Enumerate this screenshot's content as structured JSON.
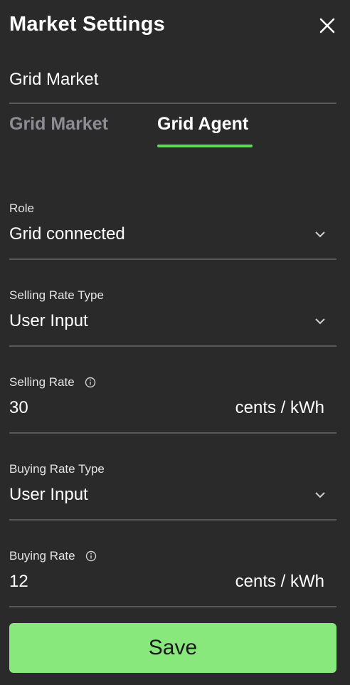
{
  "header": {
    "title": "Market Settings",
    "close_icon": "close-icon"
  },
  "name_field": {
    "value": "Grid Market"
  },
  "tabs": [
    {
      "label": "Grid Market",
      "active": false
    },
    {
      "label": "Grid Agent",
      "active": true
    }
  ],
  "fields": {
    "role": {
      "label": "Role",
      "value": "Grid connected"
    },
    "selling_rate_type": {
      "label": "Selling Rate Type",
      "value": "User Input"
    },
    "selling_rate": {
      "label": "Selling Rate",
      "value": "30",
      "unit": "cents / kWh"
    },
    "buying_rate_type": {
      "label": "Buying Rate Type",
      "value": "User Input"
    },
    "buying_rate": {
      "label": "Buying Rate",
      "value": "12",
      "unit": "cents / kWh"
    }
  },
  "save_label": "Save",
  "colors": {
    "accent": "#62d65a",
    "button": "#89e87c",
    "background": "#2b2a2b"
  }
}
